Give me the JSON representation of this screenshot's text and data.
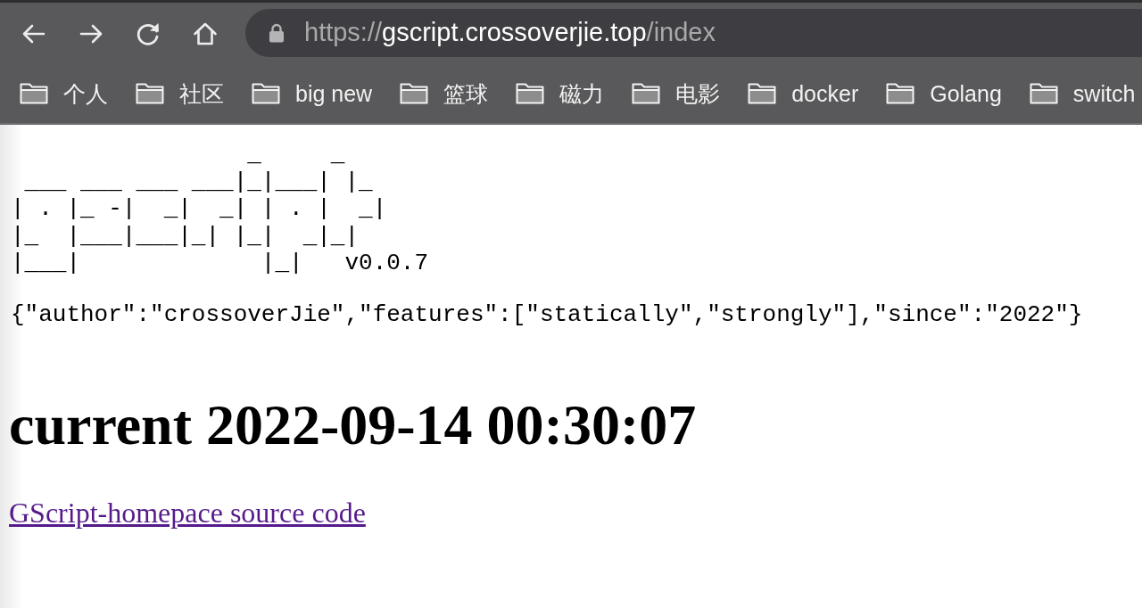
{
  "toolbar": {
    "address": {
      "scheme": "https://",
      "host": "gscript.crossoverjie.top",
      "path": "/index"
    }
  },
  "bookmarks": [
    {
      "label": "个人"
    },
    {
      "label": "社区"
    },
    {
      "label": "big new"
    },
    {
      "label": "篮球"
    },
    {
      "label": "磁力"
    },
    {
      "label": "电影"
    },
    {
      "label": "docker"
    },
    {
      "label": "Golang"
    },
    {
      "label": "switch"
    }
  ],
  "page": {
    "ascii_art": "                 _     _\n ___ ___ ___ ___|_|___| |_\n| . |_ -|  _|  _| | . |  _|\n|_  |___|___|_| |_|  _|_|\n|___|             |_|   v0.0.7",
    "info": "{\"author\":\"crossoverJie\",\"features\":[\"statically\",\"strongly\"],\"since\":\"2022\"}",
    "heading": "current 2022-09-14 00:30:07",
    "link": {
      "text": "GScript-homepace source code",
      "visited": true
    }
  }
}
